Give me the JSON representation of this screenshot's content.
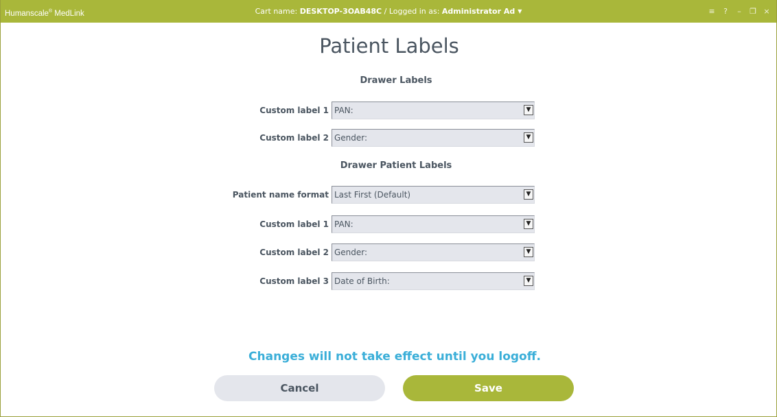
{
  "titlebar": {
    "brand": "Humanscale",
    "brand_mark": "®",
    "brand_product": "MedLink",
    "cart_label": "Cart name:",
    "cart_value": "DESKTOP-3OAB48C",
    "separator": "/",
    "logged_label": "Logged in as:",
    "logged_value": "Administrator Ad",
    "controls": {
      "menu": "≡",
      "help": "?",
      "minimize": "–",
      "restore": "❐",
      "close": "×"
    }
  },
  "page": {
    "title": "Patient Labels",
    "drawer_labels": {
      "heading": "Drawer Labels",
      "fields": [
        {
          "label": "Custom label 1",
          "value": "PAN:"
        },
        {
          "label": "Custom label 2",
          "value": "Gender:"
        }
      ]
    },
    "drawer_patient_labels": {
      "heading": "Drawer Patient Labels",
      "fields": [
        {
          "label": "Patient name format",
          "value": "Last First (Default)"
        },
        {
          "label": "Custom label 1",
          "value": "PAN:"
        },
        {
          "label": "Custom label 2",
          "value": "Gender:"
        },
        {
          "label": "Custom label 3",
          "value": "Date of Birth:"
        }
      ]
    },
    "notice": "Changes will not take effect until you logoff.",
    "cancel_label": "Cancel",
    "save_label": "Save"
  },
  "colors": {
    "accent": "#a9b73a",
    "notice": "#3aaed8",
    "text": "#4a5560",
    "select_bg": "#e4e6ec"
  }
}
